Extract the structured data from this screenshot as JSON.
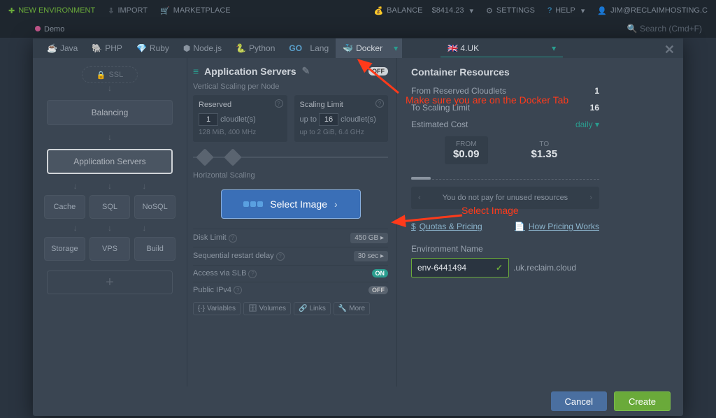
{
  "topbar": {
    "new_environment": "NEW ENVIRONMENT",
    "import": "IMPORT",
    "marketplace": "MARKETPLACE",
    "balance_label": "BALANCE",
    "balance_value": "$8414.23",
    "settings": "SETTINGS",
    "help": "HELP",
    "user": "JIM@RECLAIMHOSTING.C"
  },
  "tabbar": {
    "demo": "Demo"
  },
  "search_placeholder": "Search (Cmd+F)",
  "langs": {
    "java": "Java",
    "php": "PHP",
    "ruby": "Ruby",
    "node": "Node.js",
    "python": "Python",
    "go": "Lang",
    "docker": "Docker"
  },
  "region": {
    "label": "4.UK"
  },
  "left": {
    "ssl": "SSL",
    "balancing": "Balancing",
    "app_servers": "Application Servers",
    "cache": "Cache",
    "sql": "SQL",
    "nosql": "NoSQL",
    "storage": "Storage",
    "vps": "VPS",
    "build": "Build"
  },
  "mid": {
    "title": "Application Servers",
    "off": "OFF",
    "vscale": "Vertical Scaling per Node",
    "reserved": "Reserved",
    "reserved_n": "1",
    "cloudlets": "cloudlet(s)",
    "reserved_sub": "128 MiB, 400 MHz",
    "limit": "Scaling Limit",
    "limit_up": "up to",
    "limit_n": "16",
    "limit_sub": "up to 2 GiB, 6.4 GHz",
    "hscale": "Horizontal Scaling",
    "select_image": "Select Image",
    "disk": "Disk Limit",
    "disk_v": "450 GB",
    "restart": "Sequential restart delay",
    "restart_v": "30 sec",
    "slb": "Access via SLB",
    "on": "ON",
    "ipv4": "Public IPv4",
    "off2": "OFF",
    "vars": "Variables",
    "vols": "Volumes",
    "links": "Links",
    "more": "More"
  },
  "right": {
    "title": "Container Resources",
    "from_reserved": "From Reserved Cloudlets",
    "from_reserved_v": "1",
    "to_limit": "To Scaling Limit",
    "to_limit_v": "16",
    "est": "Estimated Cost",
    "period": "daily",
    "from_l": "FROM",
    "from_v": "$0.09",
    "to_l": "TO",
    "to_v": "$1.35",
    "nopay": "You do not pay for unused resources",
    "quotas": "Quotas & Pricing",
    "howprice": "How Pricing Works",
    "env_label": "Environment Name",
    "env_value": "env-6441494",
    "env_domain": ".uk.reclaim.cloud"
  },
  "footer": {
    "cancel": "Cancel",
    "create": "Create"
  },
  "anno": {
    "tab": "Make sure you are on the Docker Tab",
    "img": "Select Image"
  }
}
